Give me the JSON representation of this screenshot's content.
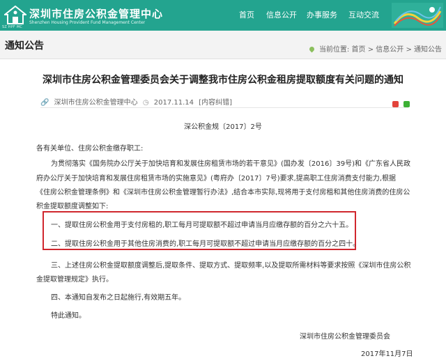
{
  "header": {
    "title": "深圳市住房公积金管理中心",
    "subtitle_en": "Shenzhen Housing Provident Fund Management Center",
    "logo_caption": "SZ HPF MC",
    "nav": [
      "首页",
      "信息公开",
      "办事服务",
      "互动交流"
    ]
  },
  "page": {
    "section_title": "通知公告",
    "breadcrumb": {
      "prefix": "当前位置:",
      "items": [
        "首页",
        "信息公开",
        "通知公告"
      ],
      "separator": " > "
    }
  },
  "article": {
    "title": "深圳市住房公积金管理委员会关于调整我市住房公积金租房提取额度有关问题的通知",
    "source": "深圳市住房公积金管理中心",
    "date": "2017.11.14",
    "feedback": "[内容纠错]",
    "doc_number": "深公积金规〔2017〕2号",
    "salutation": "各有关单位、住房公积金缴存职工:",
    "para1": [
      "为贯彻落实《国务院办公厅关于加快培育和发展住房租赁市场的若干意见》(国办发〔2016〕39号)和《广东省人民政",
      "府办公厅关于加快培育和发展住房租赁市场的实施意见》(粤府办〔2017〕7号)要求,提高职工住房消费支付能力,根据",
      "《住房公积金管理条例》和《深圳市住房公积金管理暂行办法》,结合本市实际,现将用于支付房租和其他住房消费的住房公",
      "积金提取额度调整如下:"
    ],
    "item1": "一、提取住房公积金用于支付房租的,职工每月可提取额不超过申请当月应缴存额的百分之六十五。",
    "item2": "二、提取住房公积金用于其他住房消费的,职工每月可提取额不超过申请当月应缴存额的百分之四十。",
    "item3": [
      "三、上述住房公积金提取额度调整后,提取条件、提取方式、提取频率,以及提取所需材料等要求按照《深圳市住房公积",
      "金提取管理规定》执行。"
    ],
    "item4": "四、本通知自发布之日起施行,有效期五年。",
    "closing": "特此通知。",
    "signature": "深圳市住房公积金管理委员会",
    "sign_date": "2017年11月7日"
  },
  "colors": {
    "header_bg": "#23a48f",
    "highlight_border": "#d0262d"
  }
}
